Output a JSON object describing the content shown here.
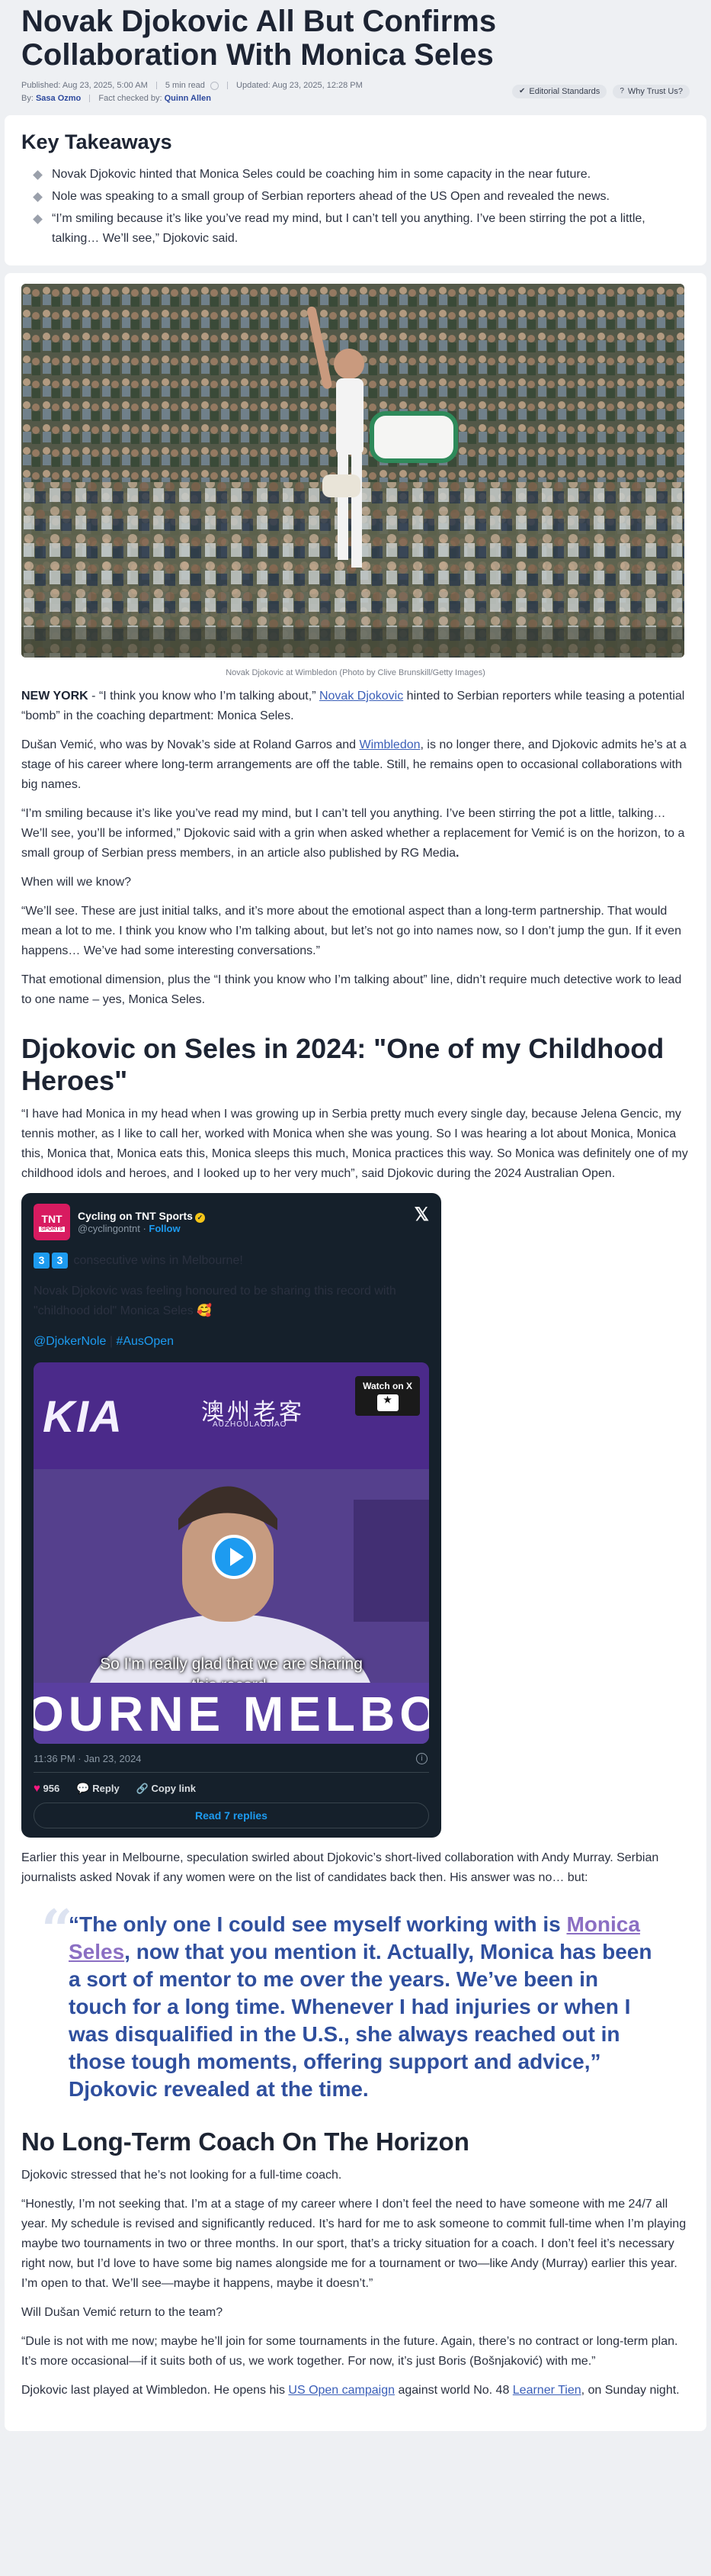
{
  "header": {
    "headline": "Novak Djokovic All But Confirms Collaboration With Monica Seles",
    "published": "Published: Aug 23, 2025, 5:00 AM",
    "read_time": "5 min read",
    "updated": "Updated: Aug 23, 2025, 12:28 PM",
    "by_label": "By:",
    "author": "Sasa Ozmo",
    "fact_label": "Fact checked by:",
    "fact_checker": "Quinn Allen",
    "badge_editorial": "Editorial Standards",
    "badge_trust": "Why Trust Us?"
  },
  "takeaways": {
    "title": "Key Takeaways",
    "items": [
      "Novak Djokovic hinted that Monica Seles could be coaching him in some capacity in the near future.",
      "Nole was speaking to a small group of Serbian reporters ahead of the US Open and revealed the news.",
      "“I’m smiling because it’s like you’ve read my mind, but I can’t tell you anything. I’ve been stirring the pot a little, talking… We’ll see,” Djokovic said."
    ]
  },
  "article": {
    "caption": "Novak Djokovic at Wimbledon (Photo by Clive Brunskill/Getty Images)",
    "p1_dateline": "NEW YORK",
    "p1_a": " - “I think you know who I’m talking about,” ",
    "p1_link": "Novak Djokovic",
    "p1_b": " hinted to Serbian reporters while teasing a potential “bomb” in the coaching department: Monica Seles.",
    "p2_a": "Dušan Vemić, who was by Novak’s side at Roland Garros and ",
    "p2_link": "Wimbledon",
    "p2_b": ", is no longer there, and Djokovic admits he’s at a stage of his career where long-term arrangements are off the table. Still, he remains open to occasional collaborations with big names.",
    "p3_a": "“I’m smiling because it’s like you’ve read my mind, but I can’t tell you anything. I’ve been stirring the pot a little, talking… We’ll see, you’ll be informed,” Djokovic said with a grin when asked whether a replacement for Vemić is on the horizon, to a small group of Serbian press members, in an article also published by RG Media",
    "p3_b": ".",
    "p4": "When will we know?",
    "p5": "“We’ll see. These are just initial talks, and it’s more about the emotional aspect than a long-term partnership. That would mean a lot to me. I think you know who I’m talking about, but let’s not go into names now, so I don’t jump the gun. If it even happens… We’ve had some interesting conversations.”",
    "p6": "That emotional dimension, plus the “I think you know who I’m talking about” line, didn’t require much detective work to lead to one name – yes, Monica Seles.",
    "h2_1": "Djokovic on Seles in 2024: \"One of my Childhood Heroes\"",
    "p7": "“I have had Monica in my head when I was growing up in Serbia pretty much every single day, because Jelena Gencic, my tennis mother, as I like to call her, worked with Monica when she was young. So I was hearing a lot about Monica, Monica this, Monica that, Monica eats this, Monica sleeps this much, Monica practices this way. So Monica was definitely one of my childhood idols and heroes, and I looked up to her very much”, said Djokovic during the 2024 Australian Open.",
    "p8": "Earlier this year in Melbourne, speculation swirled about Djokovic’s short-lived collaboration with Andy Murray. Serbian journalists asked Novak if any women were on the list of candidates back then. His answer was no… but:",
    "quote_a": "“The only one I could see myself working with is ",
    "quote_link": "Monica Seles",
    "quote_b": ", now that you mention it. Actually, Monica has been a sort of mentor to me over the years. We’ve been in touch for a long time. Whenever I had injuries or when I was disqualified in the U.S., she always reached out in those tough moments, offering support and advice,” Djokovic revealed at the time.",
    "h2_2": "No Long-Term Coach On The Horizon",
    "p9": "Djokovic stressed that he’s not looking for a full-time coach.",
    "p10": "“Honestly, I’m not seeking that. I’m at a stage of my career where I don’t feel the need to have someone with me 24/7 all year. My schedule is revised and significantly reduced. It’s hard for me to ask someone to commit full-time when I’m playing maybe two tournaments in two or three months. In our sport, that’s a tricky situation for a coach. I don’t feel it’s necessary right now, but I’d love to have some big names alongside me for a tournament or two—like Andy (Murray) earlier this year. I’m open to that. We’ll see—maybe it happens, maybe it doesn’t.”",
    "p11": "Will Dušan Vemić return to the team?",
    "p12": "“Dule is not with me now; maybe he’ll join for some tournaments in the future. Again, there’s no contract or long-term plan. It’s more occasional—if it suits both of us, we work together. For now, it’s just Boris (Bošnjaković) with me.”",
    "p13_a": "Djokovic last played at Wimbledon. He opens his ",
    "p13_link1": "US Open campaign",
    "p13_b": " against world No. 48 ",
    "p13_link2": "Learner Tien",
    "p13_c": ", on Sunday night."
  },
  "tweet": {
    "avatar_text": "TNT",
    "avatar_sub": "SPORTS",
    "name": "Cycling on TNT Sports",
    "handle": "@cyclingontnt",
    "follow": "Follow",
    "num1": "3",
    "num2": "3",
    "line1": " consecutive wins in Melbourne!",
    "line2": "Novak Djokovic was feeling honoured to be sharing this record with \"childhood idol\" Monica Seles 🥰",
    "tag1": "@DjokerNole",
    "tag_sep": " | ",
    "tag2": "#AusOpen",
    "watch": "Watch on X",
    "video_brand": "KIA",
    "video_chinese": "澳州老客",
    "video_chinese_sub": "AUZHOULAOJIAO",
    "subtitle": "So I'm really glad that we are sharing this record.",
    "banner": "OURNE  MELBOU",
    "time": "11:36 PM · Jan 23, 2024",
    "likes": "956",
    "reply": "Reply",
    "copy": "Copy link",
    "read_replies": "Read 7 replies"
  }
}
